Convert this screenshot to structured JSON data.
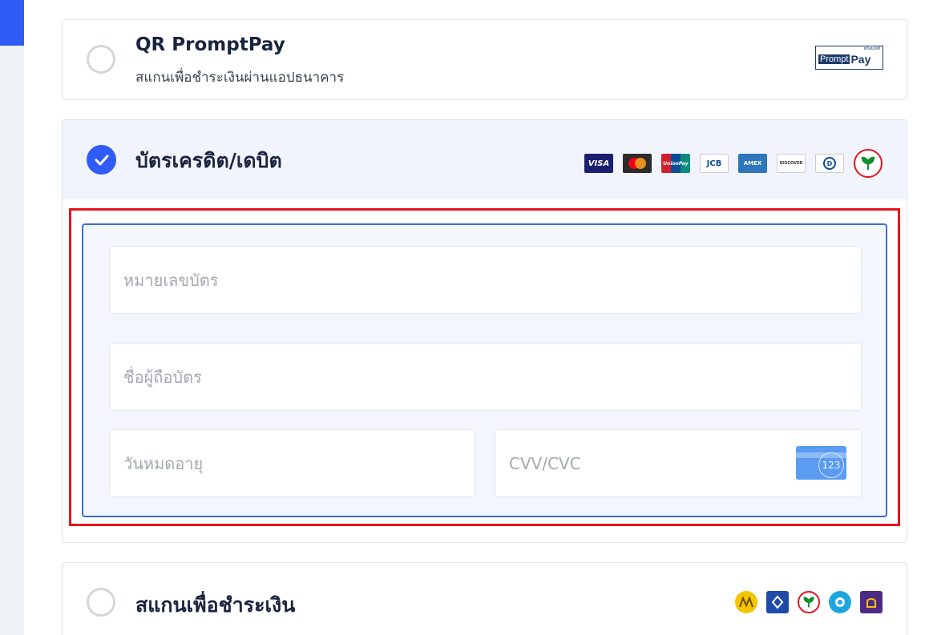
{
  "payment_options": {
    "qr": {
      "title": "QR PromptPay",
      "subtitle": "สแกนเพื่อชำระเงินผ่านแอปธนาคาร",
      "logo_small": "พร้อมเพย์",
      "logo_text": "Prompt",
      "logo_text_bold": "Pay"
    },
    "credit": {
      "title": "บัตรเครดิต/เดบิต",
      "brands": [
        "VISA",
        "",
        "UnionPay",
        "JCB",
        "AMEX",
        "DISCOVER",
        "D",
        ""
      ],
      "card_number_placeholder": "หมายเลขบัตร",
      "card_holder_placeholder": "ชื่อผู้ถือบัตร",
      "expiry_placeholder": "วันหมดอายุ",
      "cvv_placeholder": "CVV/CVC",
      "cvv_hint": "123"
    },
    "scan": {
      "title": "สแกนเพื่อชำระเงิน",
      "banks": [
        "krungsri-icon",
        "bangkok-bank-icon",
        "kbank-icon",
        "ktb-icon",
        "scb-icon"
      ]
    }
  },
  "colors": {
    "accent": "#2f5cf6",
    "highlight": "#e6141b",
    "form_border": "#3a6de0"
  }
}
